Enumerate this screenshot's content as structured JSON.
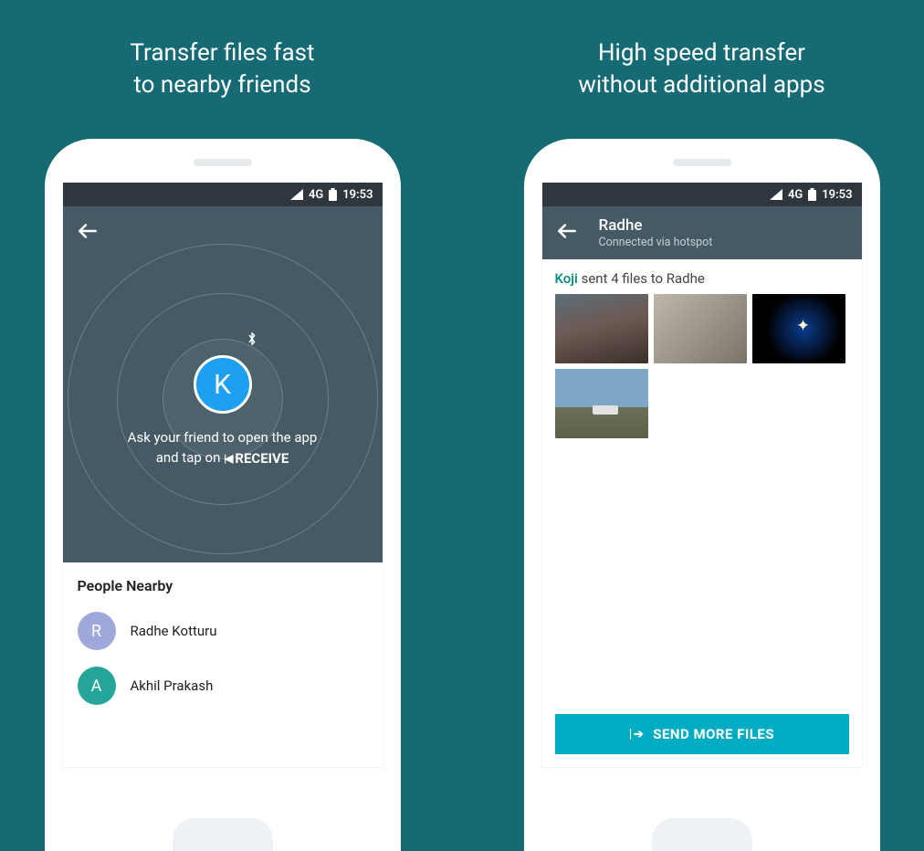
{
  "left": {
    "headline": "Transfer files fast\nto nearby friends",
    "statusbar": {
      "network_label": "4G",
      "time": "19:53"
    },
    "radar": {
      "center_letter": "K",
      "instruction_line1": "Ask your friend to open the app",
      "instruction_line2_prefix": "and tap on ",
      "instruction_receive": "RECEIVE"
    },
    "nearby": {
      "title": "People Nearby",
      "people": [
        {
          "initial": "R",
          "name": "Radhe Kotturu",
          "color": "#9fa8da"
        },
        {
          "initial": "A",
          "name": "Akhil Prakash",
          "color": "#26a69a"
        }
      ]
    }
  },
  "right": {
    "headline": "High speed transfer\nwithout additional apps",
    "statusbar": {
      "network_label": "4G",
      "time": "19:53"
    },
    "appbar": {
      "title": "Radhe",
      "subtitle": "Connected via hotspot"
    },
    "sent_summary": {
      "sender": "Koji",
      "rest": " sent 4 files to Radhe"
    },
    "send_more_label": "SEND MORE FILES"
  }
}
